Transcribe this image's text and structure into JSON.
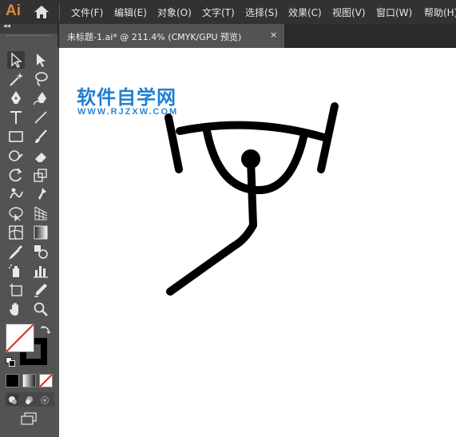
{
  "app": {
    "logo": "Ai"
  },
  "menu": [
    "文件(F)",
    "编辑(E)",
    "对象(O)",
    "文字(T)",
    "选择(S)",
    "效果(C)",
    "视图(V)",
    "窗口(W)",
    "帮助(H)"
  ],
  "document_tab": {
    "title": "未标题-1.ai* @ 211.4% (CMYK/GPU 预览)",
    "close": "×"
  },
  "toolbar": {
    "collapse": "◂◂"
  },
  "watermark": {
    "title": "软件自学网",
    "url": "WWW.RJZXW.COM"
  },
  "colors": {
    "menubar": "#323232",
    "panel": "#535353",
    "accent": "#1f7fd1",
    "logo": "#d88a3c"
  }
}
